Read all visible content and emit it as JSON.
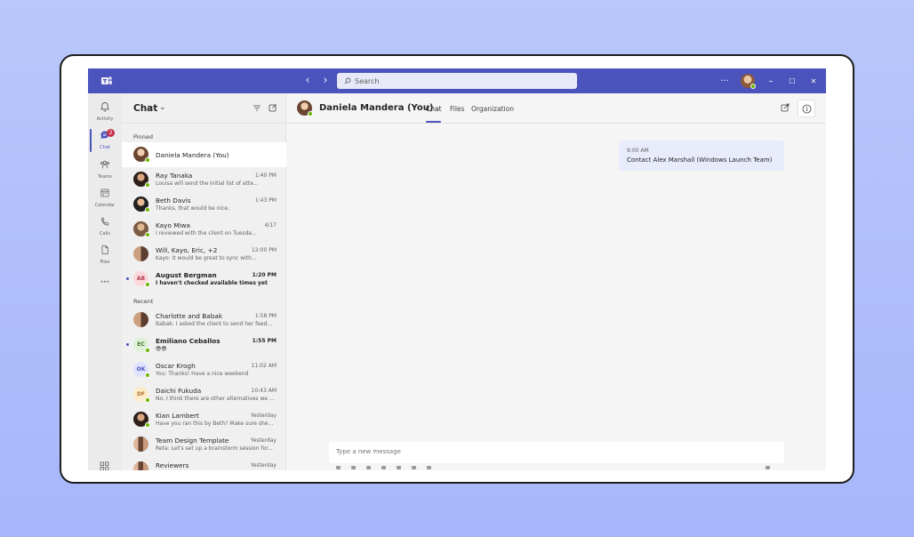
{
  "titlebar": {
    "search_placeholder": "Search",
    "more_label": "···",
    "minimize_label": "–",
    "maximize_label": "☐",
    "close_label": "✕"
  },
  "rail": {
    "items": [
      {
        "label": "Activity",
        "icon": "bell-icon"
      },
      {
        "label": "Chat",
        "icon": "chat-icon",
        "badge": "2"
      },
      {
        "label": "Teams",
        "icon": "teams-icon"
      },
      {
        "label": "Calendar",
        "icon": "calendar-icon"
      },
      {
        "label": "Calls",
        "icon": "phone-icon"
      },
      {
        "label": "Files",
        "icon": "file-icon"
      }
    ],
    "more_label": "···"
  },
  "chat_list": {
    "title": "Chat",
    "pinned_label": "Pinned",
    "recent_label": "Recent",
    "pinned": [
      {
        "name": "Daniela Mandera (You)",
        "time": "",
        "preview": ""
      },
      {
        "name": "Ray Tanaka",
        "time": "1:40 PM",
        "preview": "Louisa will send the initial list of atte..."
      },
      {
        "name": "Beth Davis",
        "time": "1:43 PM",
        "preview": "Thanks, that would be nice."
      },
      {
        "name": "Kayo Miwa",
        "time": "4/17",
        "preview": "I reviewed with the client on Tuesda..."
      },
      {
        "name": "Will, Kayo, Eric, +2",
        "time": "12:00 PM",
        "preview": "Kayo: It would be great to sync with..."
      },
      {
        "name": "August Bergman",
        "initials": "AB",
        "time": "1:20 PM",
        "preview": "I haven't checked available times yet"
      }
    ],
    "recent": [
      {
        "name": "Charlotte and Babak",
        "time": "1:58 PM",
        "preview": "Babak: I asked the client to send her feed..."
      },
      {
        "name": "Emiliano Ceballos",
        "initials": "EC",
        "time": "1:55 PM",
        "preview": "😎😎"
      },
      {
        "name": "Oscar Krogh",
        "initials": "OK",
        "time": "11:02 AM",
        "preview": "You: Thanks! Have a nice weekend"
      },
      {
        "name": "Daichi Fukuda",
        "initials": "DF",
        "time": "10:43 AM",
        "preview": "No, I think there are other alternatives we c..."
      },
      {
        "name": "Kian Lambert",
        "time": "Yesterday",
        "preview": "Have you ran this by Beth? Make sure she is..."
      },
      {
        "name": "Team Design Template",
        "time": "Yesterday",
        "preview": "Reta: Let's set up a brainstorm session for..."
      },
      {
        "name": "Reviewers",
        "time": "Yesterday",
        "preview": ""
      }
    ]
  },
  "main": {
    "contact_name": "Daniela Mandera (You)",
    "tabs": [
      "Chat",
      "Files",
      "Organization"
    ],
    "message": {
      "time": "9:00 AM",
      "text": "Contact Alex Marshall (Windows Launch Team)"
    },
    "composer_placeholder": "Type a new message"
  },
  "colors": {
    "accent": "#4b53bc",
    "presence": "#6bb700",
    "badge": "#c4314b"
  }
}
